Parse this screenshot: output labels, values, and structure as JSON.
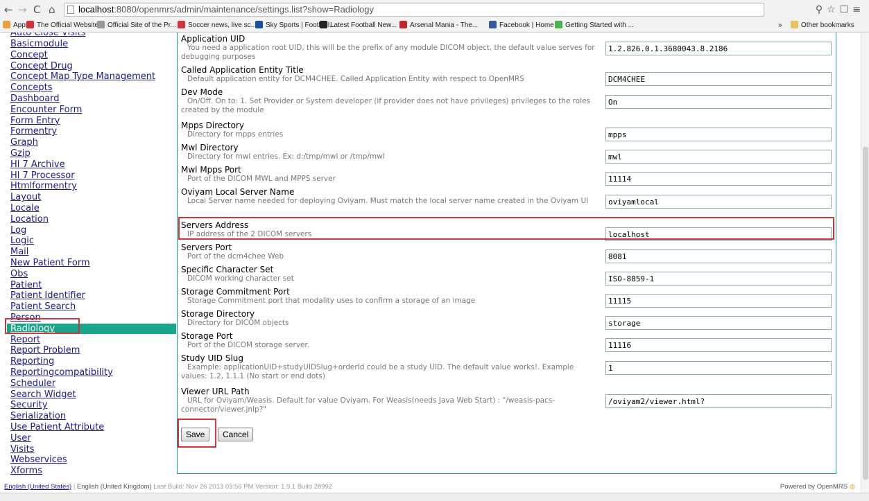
{
  "browser": {
    "url_host": "localhost",
    "url_rest": ":8080/openmrs/admin/maintenance/settings.list?show=Radiology",
    "bookmarks": [
      {
        "label": "Apps",
        "color": "#e8a33c"
      },
      {
        "label": "The Official Website...",
        "color": "#d0333a"
      },
      {
        "label": "Official Site of the Pr...",
        "color": "#999999"
      },
      {
        "label": "Soccer news, live sc...",
        "color": "#d0333a"
      },
      {
        "label": "Sky Sports | Football...",
        "color": "#1a4f9c"
      },
      {
        "label": "Latest Football New...",
        "color": "#222222"
      },
      {
        "label": "Arsenal Mania - The...",
        "color": "#c0282e"
      },
      {
        "label": "Facebook | Home",
        "color": "#3b5998"
      },
      {
        "label": "Getting Started with ...",
        "color": "#4caf50"
      }
    ],
    "other_bookmarks": "Other bookmarks",
    "overflow": "»"
  },
  "sidebar": {
    "items": [
      "Basicmodule",
      "Concept",
      "Concept Drug",
      "Concept Map Type Management",
      "Concepts",
      "Dashboard",
      "Encounter Form",
      "Form Entry",
      "Formentry",
      "Graph",
      "Gzip",
      "Hl 7 Archive",
      "Hl 7 Processor",
      "Htmlformentry",
      "Layout",
      "Locale",
      "Location",
      "Log",
      "Logic",
      "Mail",
      "New Patient Form",
      "Obs",
      "Patient",
      "Patient Identifier",
      "Patient Search",
      "Person",
      "Radiology",
      "Report",
      "Report Problem",
      "Reporting",
      "Reportingcompatibility",
      "Scheduler",
      "Search Widget",
      "Security",
      "Serialization",
      "Use Patient Attribute",
      "User",
      "Visits",
      "Webservices",
      "Xforms"
    ],
    "selected": "Radiology"
  },
  "settings": [
    {
      "title": "Application UID",
      "desc": "You need a application root UID, this will be the prefix of any module DICOM object, the default value serves for debugging purposes",
      "value": "1.2.826.0.1.3680043.8.2186"
    },
    {
      "title": "Called Application Entity Title",
      "desc": "Default application entity for DCM4CHEE. Called Application Entity with respect to OpenMRS",
      "value": "DCM4CHEE"
    },
    {
      "title": "Dev Mode",
      "desc": "On/Off. On to: 1. Set Provider or System developer (if provider does not have privileges) privileges to the roles created by the module",
      "value": "On"
    },
    {
      "title": "Mpps Directory",
      "desc": "Directory for mpps entries",
      "value": "mpps"
    },
    {
      "title": "Mwl Directory",
      "desc": "Directory for mwl entries. Ex: d:/tmp/mwl or /tmp/mwl",
      "value": "mwl"
    },
    {
      "title": "Mwl Mpps Port",
      "desc": "Port of the DICOM MWL and MPPS server",
      "value": "11114"
    },
    {
      "title": "Oviyam Local Server Name",
      "desc": "Local Server name needed for deploying Oviyam. Must match the local server name created in the Oviyam UI",
      "value": "oviyamlocal"
    },
    {
      "title": "Servers Address",
      "desc": "IP address of the 2 DICOM servers",
      "value": "localhost"
    },
    {
      "title": "Servers Port",
      "desc": "Port of the dcm4chee Web",
      "value": "8081"
    },
    {
      "title": "Specific Character Set",
      "desc": "DICOM working character set",
      "value": "ISO-8859-1"
    },
    {
      "title": "Storage Commitment Port",
      "desc": "Storage Commitment port that modality uses to confirm a storage of an image",
      "value": "11115"
    },
    {
      "title": "Storage Directory",
      "desc": "Directory for DICOM objects",
      "value": "storage"
    },
    {
      "title": "Storage Port",
      "desc": "Port of the DICOM storage server.",
      "value": "11116"
    },
    {
      "title": "Study UID Slug",
      "desc": "Example: applicationUID+studyUIDSlug+orderId could be a study UID. The default value works!. Example values: 1.2, 1.1.1 (No start or end dots)",
      "value": "1"
    },
    {
      "title": "Viewer URL Path",
      "desc": "URL for Oviyam/Weasis. Default for value Oviyam. For Weasis(needs Java Web Start) : \"/weasis-pacs-connector/viewer.jnlp?\"",
      "value": "/oviyam2/viewer.html?"
    }
  ],
  "buttons": {
    "save": "Save",
    "cancel": "Cancel"
  },
  "footer": {
    "lang_us": "English (United States)",
    "sep": "|",
    "lang_uk": "English (United Kingdom)",
    "build": "Last Build: Nov 26 2013 03:56 PM  Version: 1.9.1 Build 28992",
    "powered": "Powered by OpenMRS"
  }
}
